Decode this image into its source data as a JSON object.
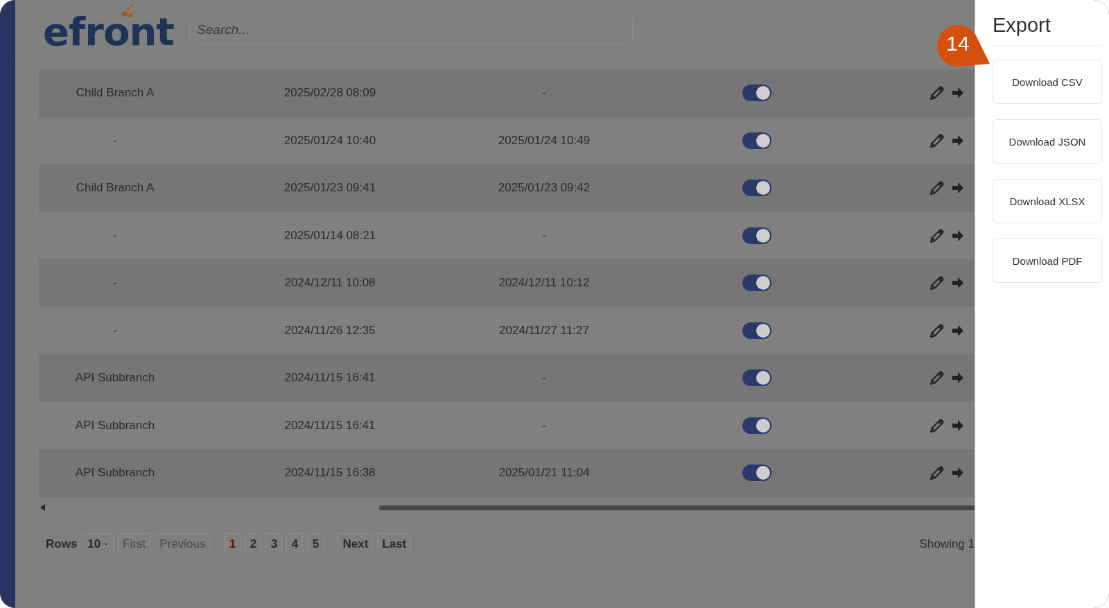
{
  "logo": {
    "text": "efront"
  },
  "search": {
    "placeholder": "Search..."
  },
  "table": {
    "rows": [
      {
        "cells": [
          "Child Branch A",
          "2025/02/28 08:09",
          "-"
        ],
        "on": true
      },
      {
        "cells": [
          "-",
          "2025/01/24 10:40",
          "2025/01/24 10:49"
        ],
        "on": true
      },
      {
        "cells": [
          "Child Branch A",
          "2025/01/23 09:41",
          "2025/01/23 09:42"
        ],
        "on": true
      },
      {
        "cells": [
          "-",
          "2025/01/14 08:21",
          "-"
        ],
        "on": true
      },
      {
        "cells": [
          "-",
          "2024/12/11 10:08",
          "2024/12/11 10:12"
        ],
        "on": true
      },
      {
        "cells": [
          "-",
          "2024/11/26 12:35",
          "2024/11/27 11:27"
        ],
        "on": true
      },
      {
        "cells": [
          "API Subbranch",
          "2024/11/15 16:41",
          "-"
        ],
        "on": true
      },
      {
        "cells": [
          "API Subbranch",
          "2024/11/15 16:41",
          "-"
        ],
        "on": true
      },
      {
        "cells": [
          "API Subbranch",
          "2024/11/15 16:38",
          "2025/01/21 11:04"
        ],
        "on": true
      }
    ]
  },
  "pagination": {
    "rows_label": "Rows",
    "rows_per_page": "10",
    "nav_before": [
      {
        "label": "First",
        "disabled": true
      },
      {
        "label": "Previous",
        "disabled": true
      }
    ],
    "pages": [
      {
        "label": "1",
        "selected": true
      },
      {
        "label": "2",
        "selected": false
      },
      {
        "label": "3",
        "selected": false
      },
      {
        "label": "4",
        "selected": false
      },
      {
        "label": "5",
        "selected": false
      }
    ],
    "nav_after": [
      {
        "label": "Next",
        "disabled": false
      },
      {
        "label": "Last",
        "disabled": false
      }
    ],
    "summary": "Showing 1"
  },
  "callout": {
    "number": "14"
  },
  "export_panel": {
    "title": "Export",
    "buttons": [
      "Download CSV",
      "Download JSON",
      "Download XLSX",
      "Download PDF"
    ]
  }
}
